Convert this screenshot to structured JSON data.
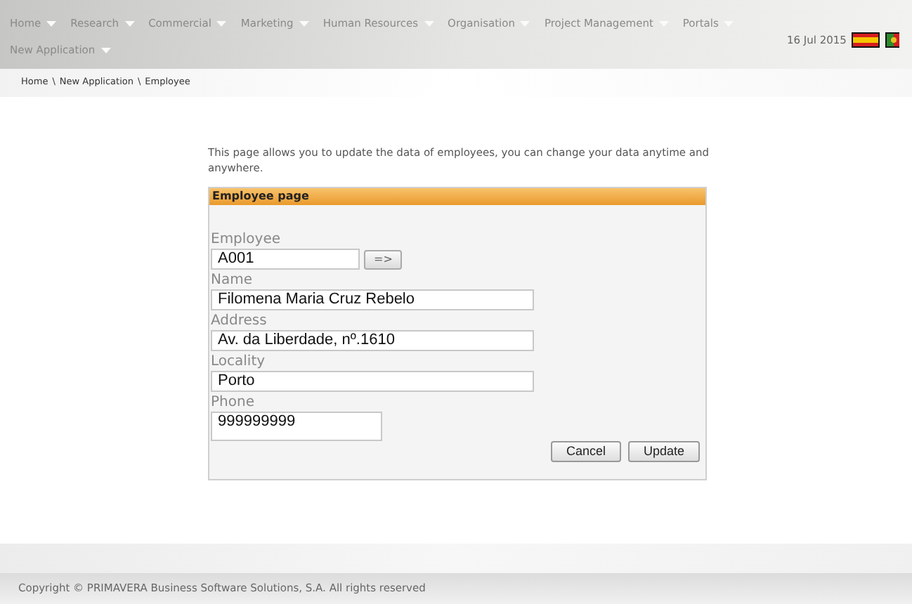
{
  "menu": [
    {
      "label": "Home"
    },
    {
      "label": "Research"
    },
    {
      "label": "Commercial"
    },
    {
      "label": "Marketing"
    },
    {
      "label": "Human Resources"
    },
    {
      "label": "Organisation"
    },
    {
      "label": "Project Management"
    },
    {
      "label": "Portals"
    },
    {
      "label": "New Application"
    }
  ],
  "date": "16 Jul 2015",
  "breadcrumb": [
    "Home",
    "New Application",
    "Employee"
  ],
  "breadcrumb_separator": "\\",
  "intro": "This page allows you to update the data of employees, you can change your data anytime and anywhere.",
  "panel": {
    "title": "Employee page",
    "fields": [
      {
        "label": "Employee",
        "value": "A001",
        "kind": "lookup",
        "button": "=>"
      },
      {
        "label": "Name",
        "value": "Filomena Maria Cruz Rebelo",
        "kind": "text"
      },
      {
        "label": "Address",
        "value": "Av. da Liberdade, nº.1610",
        "kind": "text"
      },
      {
        "label": "Locality",
        "value": "Porto",
        "kind": "text"
      },
      {
        "label": "Phone",
        "value": "999999999",
        "kind": "textarea"
      }
    ],
    "buttons": [
      "Cancel",
      "Update"
    ]
  },
  "footer": "Copyright © PRIMAVERA Business Software Solutions, S.A. All rights reserved"
}
